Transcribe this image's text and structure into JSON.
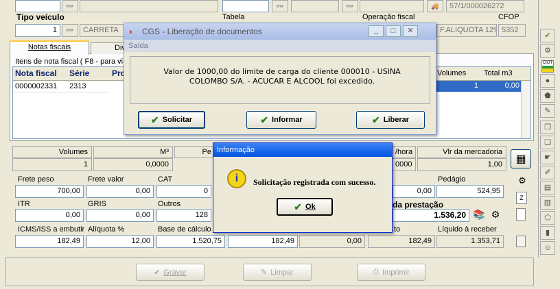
{
  "top_row": {
    "field1": "",
    "field2": "",
    "field3": "",
    "field4": "",
    "ref_value": "57/1/000026272"
  },
  "labels": {
    "tipo_veiculo": "Tipo veículo",
    "tabela": "Tabela",
    "operacao_fiscal": "Operação fiscal",
    "cfop": "CFOP"
  },
  "vehicle": {
    "code": "1",
    "name": "CARRETA"
  },
  "tabela_value": "",
  "operacao_fiscal_value": "F.ALIQUOTA 12%",
  "cfop_value": "5352",
  "tabs": {
    "notas_fiscais": "Notas fiscais",
    "div": "Div"
  },
  "items_group_title": "Itens de nota fiscal ( F8 - para vi",
  "table": {
    "col_nota": "Nota fiscal",
    "col_serie": "Série",
    "col_pro": "Pro",
    "col_volumes": "Volumes",
    "col_total_m3": "Total m3",
    "row_nota": "0000002331",
    "row_serie": "2313",
    "row_volumes": "1",
    "row_total": "0,00"
  },
  "summary": {
    "volumes_label": "Volumes",
    "m3_label": "M³",
    "pe_label": "Pe",
    "vhora_label": "/hora",
    "vlr_label": "Vlr da mercadoria",
    "volumes_value": "1",
    "m3_value": "0,0000",
    "vhora_value": "0000",
    "vlr_value": "1,00"
  },
  "charges": {
    "frete_peso_label": "Frete peso",
    "frete_valor_label": "Frete valor",
    "cat_label": "CAT",
    "pedagio_label": "Pedágio",
    "frete_peso": "700,00",
    "frete_valor": "0,00",
    "cat": "0",
    "col4_value": "0,00",
    "pedagio": "524,95",
    "itr_label": "ITR",
    "gris_label": "GRIS",
    "outros_label": "Outros",
    "prestacao_label": "da prestação",
    "itr": "0,00",
    "gris": "0,00",
    "outros": "128",
    "prestacao": "1.536,20",
    "icms_label": "ICMS/ISS a embutir",
    "aliquota_label": "Alíquota %",
    "base_label": "Base de cálculo",
    "to_label": "to",
    "liquido_label": "Líquido à receber",
    "icms": "182,49",
    "aliquota": "12,00",
    "base": "1.520,75",
    "b4": "182,49",
    "b5": "0,00",
    "b6": "182,49",
    "liquido": "1.353,71"
  },
  "bottom_buttons": {
    "gravar": "Gravar",
    "limpar": "Limpar",
    "imprimir": "Imprimir"
  },
  "cgs_dialog": {
    "title": "CGS - Liberação de documentos",
    "section": "Saída",
    "message": "Valor de 1000,00 do limite de carga do cliente 000010 - USINA COLOMBO S/A. - ACUCAR E ALCOOL foi excedido.",
    "solicitar": "Solicitar",
    "informar": "Informar",
    "liberar": "Liberar"
  },
  "info_dialog": {
    "title": "Informação",
    "message": "Solicitação registrada com sucesso.",
    "ok": "Ok"
  },
  "side_toolbar": {
    "ciot_label": "CIOT"
  }
}
